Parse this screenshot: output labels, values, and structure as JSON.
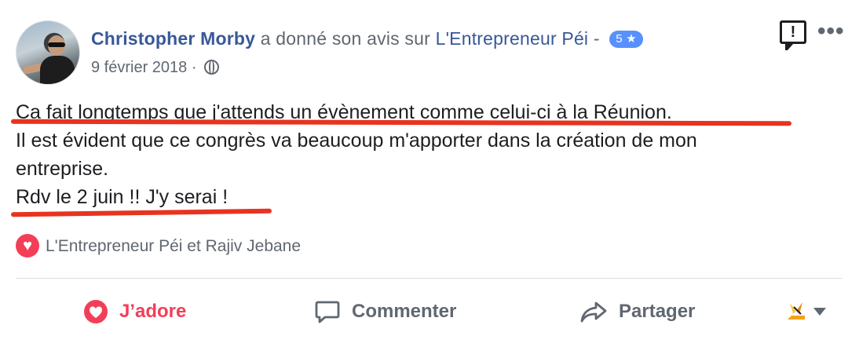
{
  "post": {
    "author": "Christopher Morby",
    "action_text": " a donné son avis sur ",
    "page_name": "L'Entrepreneur Péi",
    "separator": " - ",
    "rating": "5 ★",
    "date": "9 février 2018",
    "date_separator": " · ",
    "privacy_icon": "globe-icon",
    "lines": [
      "Ca fait longtemps que j'attends un évènement comme celui-ci à la Réunion.",
      "Il est évident que ce congrès va beaucoup m'apporter dans la création de mon",
      "entreprise.",
      "Rdv le 2 juin !! J'y serai !"
    ]
  },
  "reactions": {
    "icon": "love-reaction-icon",
    "names": "L'Entrepreneur Péi et Rajiv Jebane"
  },
  "actions": {
    "love_label": "J’adore",
    "comment_label": "Commenter",
    "share_label": "Partager"
  },
  "icons": {
    "report": "report-icon",
    "more": "more-icon",
    "sticker": "sticker-icon",
    "dropdown": "chevron-down-icon"
  },
  "colors": {
    "link": "#385898",
    "love": "#f33e58",
    "badge": "#5890ff",
    "annotation_underline": "#e8331f",
    "muted": "#606770"
  }
}
